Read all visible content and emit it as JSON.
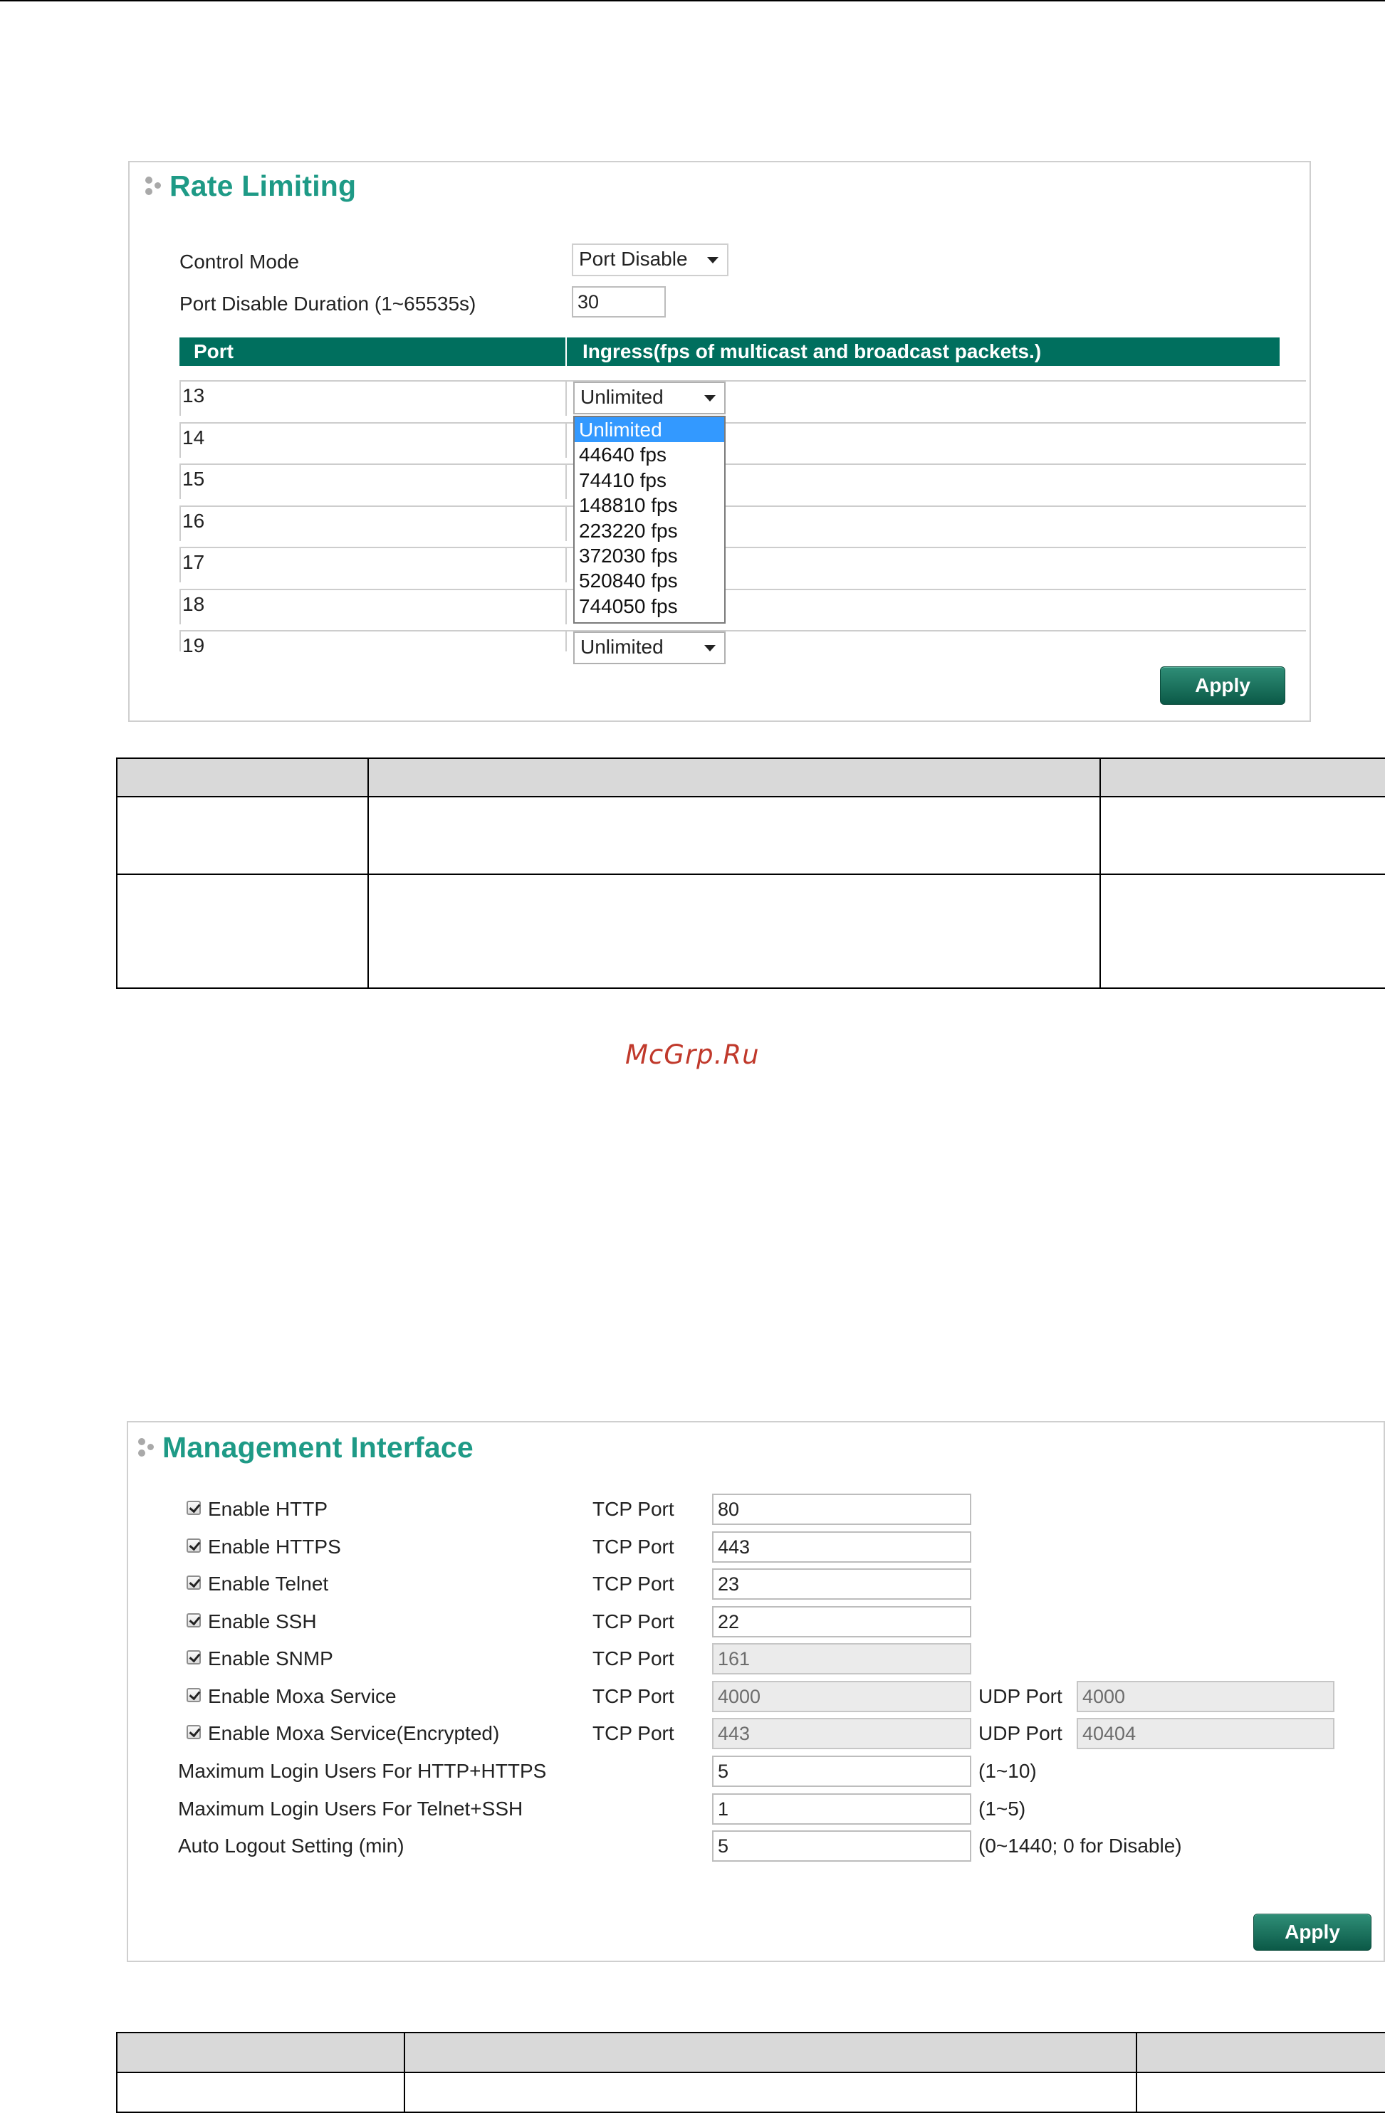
{
  "rate_limiting": {
    "title": "Rate Limiting",
    "control_mode_label": "Control Mode",
    "control_mode_value": "Port Disable",
    "duration_label": "Port Disable Duration (1~65535s)",
    "duration_value": "30",
    "table_header": {
      "port": "Port",
      "ingress": "Ingress(fps of multicast and broadcast packets.)"
    },
    "rows": [
      {
        "port": "13",
        "ingress": "Unlimited"
      },
      {
        "port": "14",
        "ingress": ""
      },
      {
        "port": "15",
        "ingress": ""
      },
      {
        "port": "16",
        "ingress": ""
      },
      {
        "port": "17",
        "ingress": ""
      },
      {
        "port": "18",
        "ingress": ""
      },
      {
        "port": "19",
        "ingress": "Unlimited"
      }
    ],
    "dropdown_options": [
      "Unlimited",
      "44640 fps",
      "74410 fps",
      "148810 fps",
      "223220 fps",
      "372030 fps",
      "520840 fps",
      "744050 fps"
    ],
    "dropdown_selected_index": 0,
    "apply_label": "Apply"
  },
  "watermark": "McGrp.Ru",
  "management_interface": {
    "title": "Management Interface",
    "services": [
      {
        "label": "Enable HTTP",
        "checked": true,
        "tcp_label": "TCP Port",
        "tcp_value": "80",
        "tcp_disabled": false
      },
      {
        "label": "Enable HTTPS",
        "checked": true,
        "tcp_label": "TCP Port",
        "tcp_value": "443",
        "tcp_disabled": false
      },
      {
        "label": "Enable Telnet",
        "checked": true,
        "tcp_label": "TCP Port",
        "tcp_value": "23",
        "tcp_disabled": false
      },
      {
        "label": "Enable SSH",
        "checked": true,
        "tcp_label": "TCP Port",
        "tcp_value": "22",
        "tcp_disabled": false
      },
      {
        "label": "Enable SNMP",
        "checked": true,
        "tcp_label": "TCP Port",
        "tcp_value": "161",
        "tcp_disabled": true
      },
      {
        "label": "Enable Moxa Service",
        "checked": true,
        "tcp_label": "TCP Port",
        "tcp_value": "4000",
        "tcp_disabled": true,
        "udp_label": "UDP Port",
        "udp_value": "4000"
      },
      {
        "label": "Enable Moxa Service(Encrypted)",
        "checked": true,
        "tcp_label": "TCP Port",
        "tcp_value": "443",
        "tcp_disabled": true,
        "udp_label": "UDP Port",
        "udp_value": "40404"
      }
    ],
    "settings": [
      {
        "label": "Maximum Login Users For HTTP+HTTPS",
        "value": "5",
        "range": "(1~10)"
      },
      {
        "label": "Maximum Login Users For Telnet+SSH",
        "value": "1",
        "range": "(1~5)"
      },
      {
        "label": "Auto Logout Setting (min)",
        "value": "5",
        "range": "(0~1440; 0 for Disable)"
      }
    ],
    "apply_label": "Apply"
  },
  "colors": {
    "title_green": "#1e9a86",
    "header_green": "#006f5e",
    "dropdown_highlight": "#3399ff",
    "watermark": "#c0392b"
  }
}
